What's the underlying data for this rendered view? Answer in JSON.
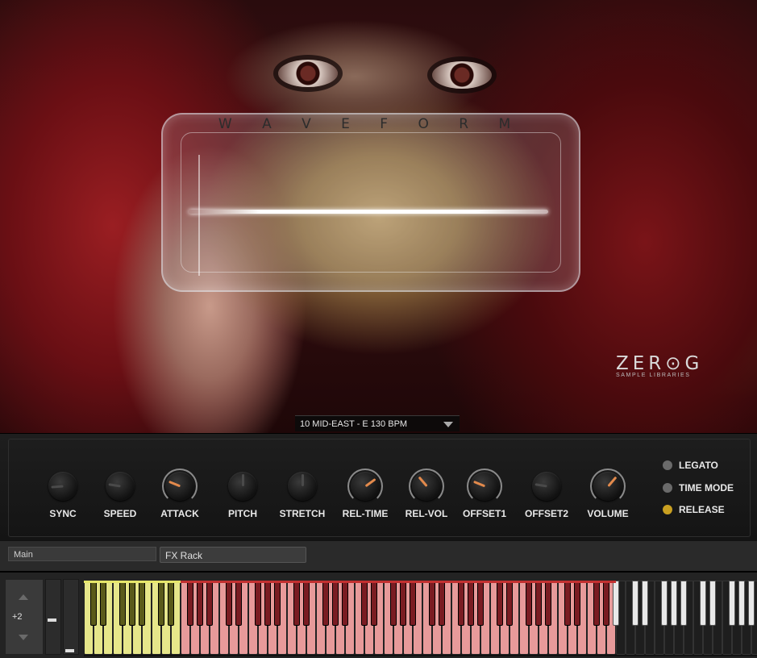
{
  "instrument": {
    "title": "W A V E F O R M",
    "preset": "10 MID-EAST - E 130 BPM",
    "logo_main": "ZER⊙G",
    "logo_sub": "SAMPLE LIBRARIES"
  },
  "knobs": [
    {
      "label": "SYNC",
      "value": 0.15,
      "active": false
    },
    {
      "label": "SPEED",
      "value": 0.2,
      "active": false
    },
    {
      "label": "ATTACK",
      "value": 0.25,
      "active": true
    },
    {
      "label": "PITCH",
      "value": 0.5,
      "active": false
    },
    {
      "label": "STRETCH",
      "value": 0.5,
      "active": false
    },
    {
      "label": "REL-TIME",
      "value": 0.7,
      "active": true
    },
    {
      "label": "REL-VOL",
      "value": 0.35,
      "active": true
    },
    {
      "label": "OFFSET1",
      "value": 0.25,
      "active": true
    },
    {
      "label": "OFFSET2",
      "value": 0.2,
      "active": false
    },
    {
      "label": "VOLUME",
      "value": 0.65,
      "active": true
    }
  ],
  "toggles": [
    {
      "label": "LEGATO",
      "on": false
    },
    {
      "label": "TIME MODE",
      "on": false
    },
    {
      "label": "RELEASE",
      "on": true
    }
  ],
  "tabs": {
    "main": "Main",
    "fx_rack": "FX Rack"
  },
  "keyboard": {
    "octave": "+2"
  },
  "colors": {
    "accent_knob": "#e38a4c",
    "release_on": "#c9a021",
    "key_yellow": "#e6e68a",
    "key_red": "#e79a9a"
  }
}
